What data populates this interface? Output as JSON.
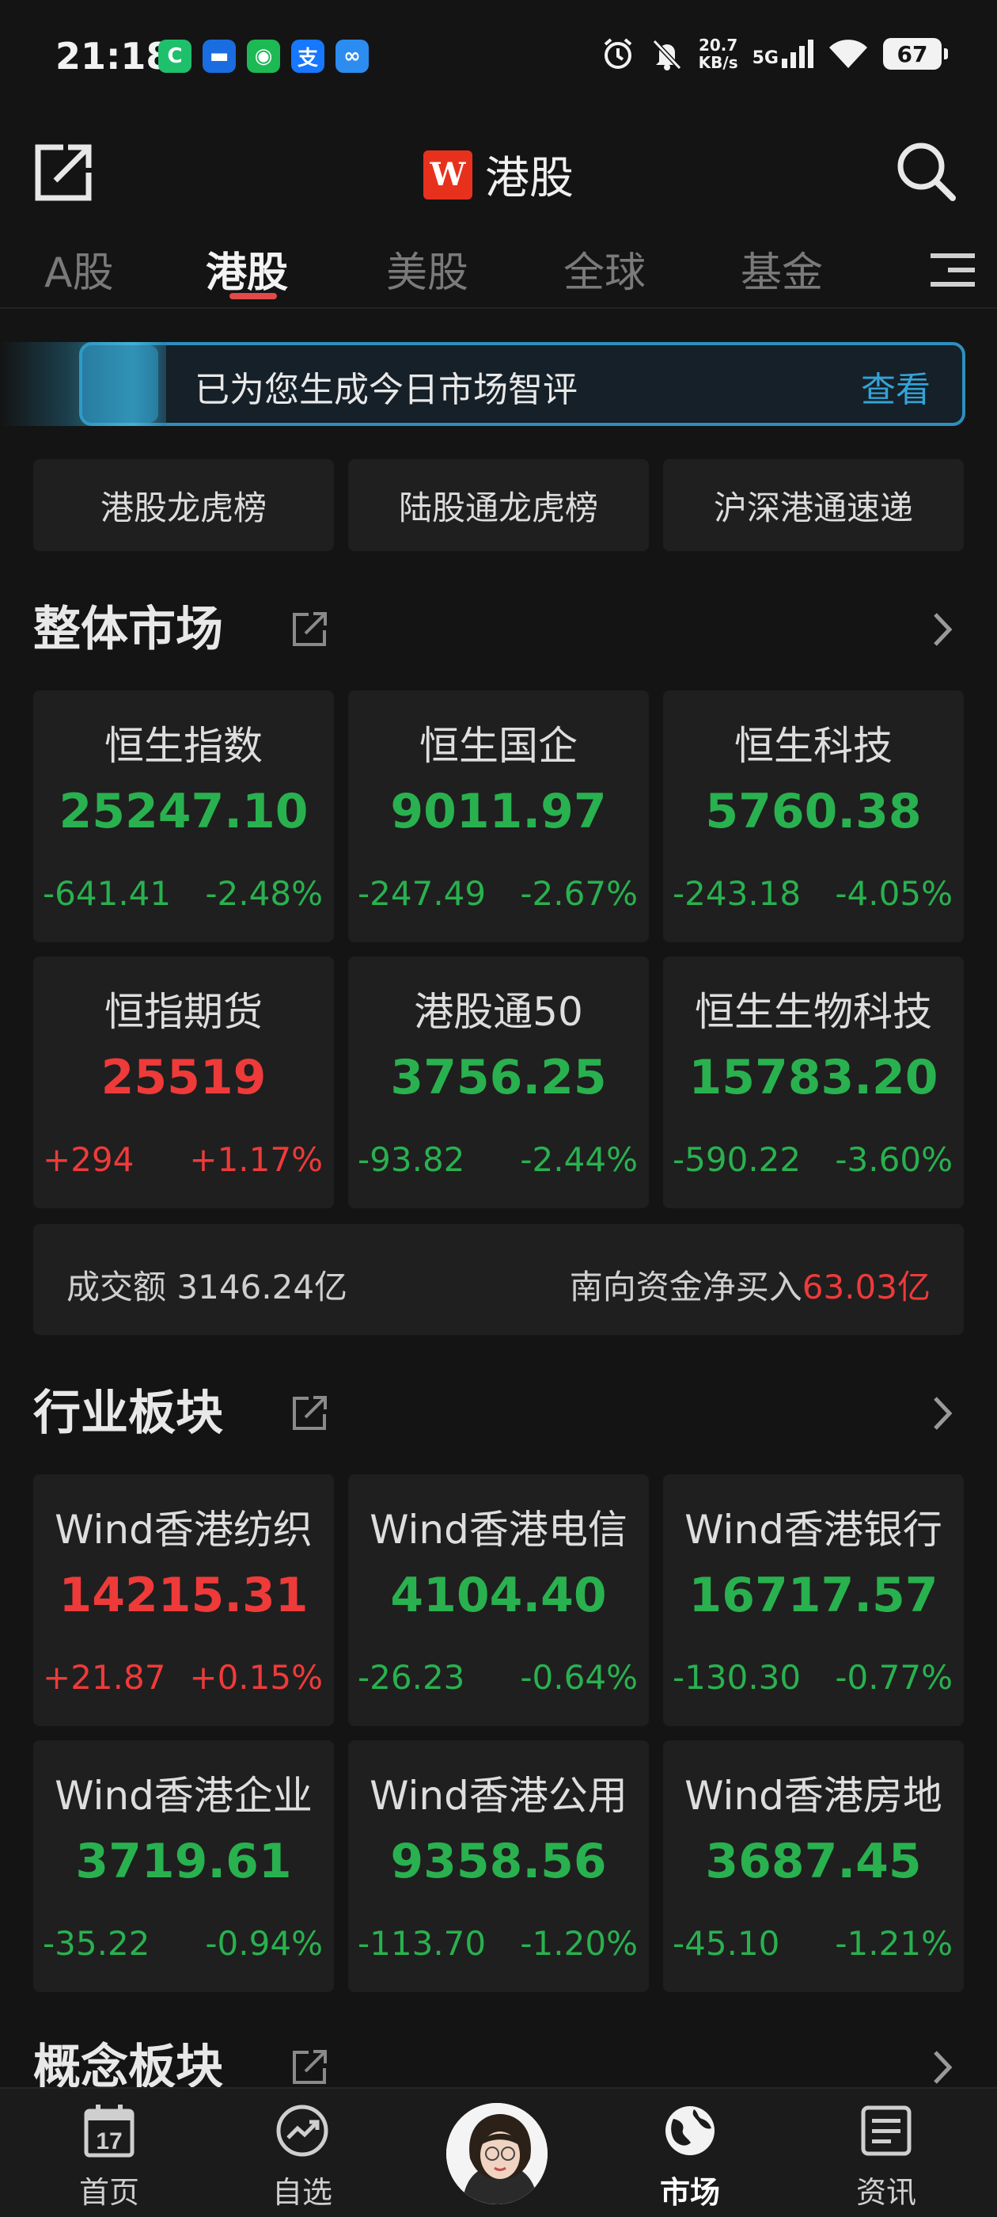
{
  "status_bar": {
    "time": "21:18",
    "apps": [
      {
        "icon": "refresh-app-icon",
        "glyph": "C",
        "color": "#1fc06c"
      },
      {
        "icon": "wallet-app-icon",
        "glyph": "▬",
        "color": "#1a6de0"
      },
      {
        "icon": "wechat-icon",
        "glyph": "◉",
        "color": "#1db954"
      },
      {
        "icon": "alipay-icon",
        "glyph": "支",
        "color": "#1677ff"
      },
      {
        "icon": "link-app-icon",
        "glyph": "∞",
        "color": "#2d8cf0"
      }
    ],
    "net_speed_value": "20.7",
    "net_speed_unit": "KB/s",
    "network": "5G",
    "battery": "67"
  },
  "header": {
    "logo_letter": "W",
    "title": "港股"
  },
  "tabs": [
    {
      "label": "A股",
      "active": false
    },
    {
      "label": "港股",
      "active": true
    },
    {
      "label": "美股",
      "active": false
    },
    {
      "label": "全球",
      "active": false
    },
    {
      "label": "基金",
      "active": false
    }
  ],
  "banner": {
    "text": "已为您生成今日市场智评",
    "link": "查看"
  },
  "quick_links": [
    "港股龙虎榜",
    "陆股通龙虎榜",
    "沪深港通速递"
  ],
  "overall_market": {
    "title": "整体市场",
    "cards": [
      {
        "name": "恒生指数",
        "value": "25247.10",
        "change": "-641.41",
        "pct": "-2.48%",
        "dir": "down"
      },
      {
        "name": "恒生国企",
        "value": "9011.97",
        "change": "-247.49",
        "pct": "-2.67%",
        "dir": "down"
      },
      {
        "name": "恒生科技",
        "value": "5760.38",
        "change": "-243.18",
        "pct": "-4.05%",
        "dir": "down"
      },
      {
        "name": "恒指期货",
        "value": "25519",
        "change": "+294",
        "pct": "+1.17%",
        "dir": "up"
      },
      {
        "name": "港股通50",
        "value": "3756.25",
        "change": "-93.82",
        "pct": "-2.44%",
        "dir": "down"
      },
      {
        "name": "恒生生物科技",
        "value": "15783.20",
        "change": "-590.22",
        "pct": "-3.60%",
        "dir": "down"
      }
    ],
    "turnover_label": "成交额",
    "turnover_value": "3146.24亿",
    "southbound_label": "南向资金净买入",
    "southbound_value": "63.03亿"
  },
  "industry": {
    "title": "行业板块",
    "cards": [
      {
        "name": "Wind香港纺织",
        "value": "14215.31",
        "change": "+21.87",
        "pct": "+0.15%",
        "dir": "up"
      },
      {
        "name": "Wind香港电信",
        "value": "4104.40",
        "change": "-26.23",
        "pct": "-0.64%",
        "dir": "down"
      },
      {
        "name": "Wind香港银行",
        "value": "16717.57",
        "change": "-130.30",
        "pct": "-0.77%",
        "dir": "down"
      },
      {
        "name": "Wind香港企业",
        "value": "3719.61",
        "change": "-35.22",
        "pct": "-0.94%",
        "dir": "down"
      },
      {
        "name": "Wind香港公用",
        "value": "9358.56",
        "change": "-113.70",
        "pct": "-1.20%",
        "dir": "down"
      },
      {
        "name": "Wind香港房地",
        "value": "3687.45",
        "change": "-45.10",
        "pct": "-1.21%",
        "dir": "down"
      }
    ]
  },
  "concept": {
    "title": "概念板块"
  },
  "bottom_nav": [
    {
      "label": "首页",
      "icon": "calendar-icon",
      "active": false
    },
    {
      "label": "自选",
      "icon": "trend-icon",
      "active": false
    },
    {
      "label": "",
      "icon": "assistant-avatar",
      "active": false
    },
    {
      "label": "市场",
      "icon": "globe-icon",
      "active": true
    },
    {
      "label": "资讯",
      "icon": "news-icon",
      "active": false
    }
  ],
  "calendar_day": "17",
  "colors": {
    "up": "#ef3a3a",
    "down": "#29b14f",
    "accent": "#33a3d6",
    "tab_underline": "#e24a4a"
  }
}
